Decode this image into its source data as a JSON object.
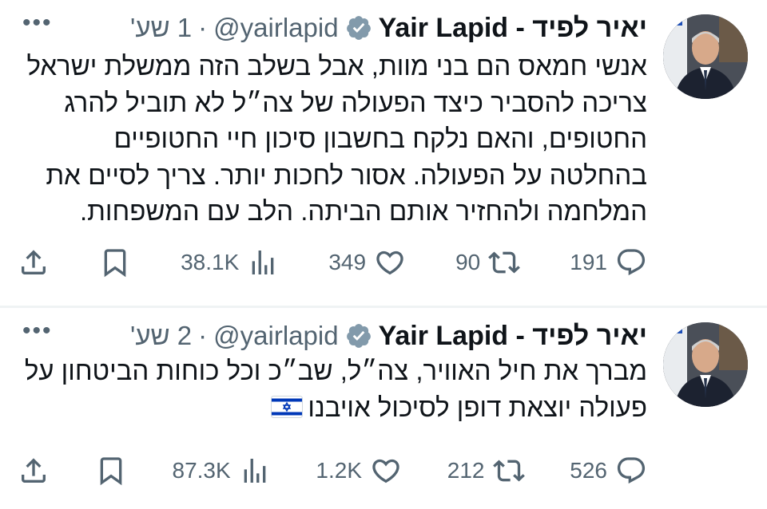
{
  "tweets": [
    {
      "name": "יאיר לפיד - Yair Lapid",
      "handle": "@yairlapid",
      "dot": "·",
      "time": "1 שע'",
      "more": "•••",
      "text": "אנשי חמאס הם בני מוות, אבל בשלב הזה ממשלת ישראל צריכה להסביר כיצד הפעולה של צה״ל לא תוביל להרג החטופים, והאם נלקח בחשבון סיכון חיי החטופיים בהחלטה על הפעולה. אסור לחכות יותר. צריך לסיים את המלחמה ולהחזיר אותם הביתה. הלב עם המשפחות.",
      "replies": "191",
      "reposts": "90",
      "likes": "349",
      "views": "38.1K"
    },
    {
      "name": "יאיר לפיד - Yair Lapid",
      "handle": "@yairlapid",
      "dot": "·",
      "time": "2 שע'",
      "more": "•••",
      "text": "מברך את חיל האוויר, צה״ל, שב״כ וכל כוחות הביטחון על פעולה יוצאת דופן לסיכול אויבנו",
      "replies": "526",
      "reposts": "212",
      "likes": "1.2K",
      "views": "87.3K"
    }
  ],
  "colors": {
    "text": "#0f1419",
    "secondary": "#536471",
    "divider": "#eff3f4",
    "flag_blue": "#0038b8"
  },
  "icons": [
    "more-icon",
    "verified-badge-icon",
    "reply-icon",
    "repost-icon",
    "like-icon",
    "views-icon",
    "bookmark-icon",
    "share-icon",
    "israel-flag-emoji"
  ]
}
